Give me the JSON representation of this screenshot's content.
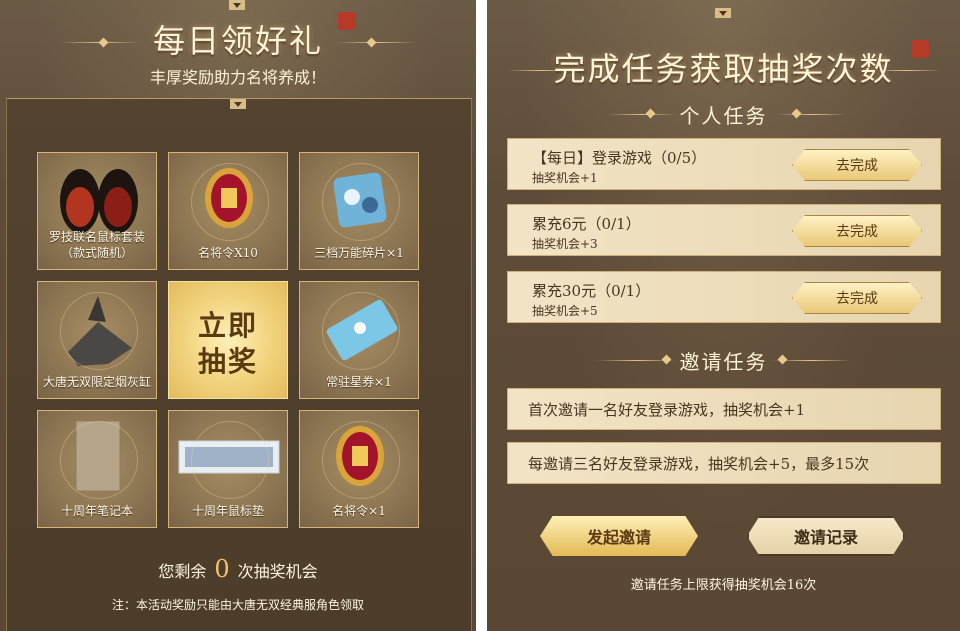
{
  "left": {
    "title": "每日领好礼",
    "subtitle": "丰厚奖励助力名将养成！",
    "grid": [
      {
        "label": "罗技联名鼠标套装\n（款式随机）",
        "icon": "mouse-set-icon"
      },
      {
        "label": "名将令X10",
        "icon": "token-icon"
      },
      {
        "label": "三档万能碎片×1",
        "icon": "fragment-icon"
      },
      {
        "label": "大唐无双限定烟灰缸",
        "icon": "ashtray-icon"
      },
      {
        "label": "立即\n抽奖",
        "icon": "draw-button"
      },
      {
        "label": "常驻星券×1",
        "icon": "ticket-icon"
      },
      {
        "label": "十周年笔记本",
        "icon": "notebook-icon"
      },
      {
        "label": "十周年鼠标垫",
        "icon": "mousepad-icon"
      },
      {
        "label": "名将令×1",
        "icon": "token-icon"
      }
    ],
    "remain_prefix": "您剩余",
    "remain_count": "0",
    "remain_suffix": "次抽奖机会",
    "note": "注：本活动奖励只能由大唐无双经典服角色领取"
  },
  "right": {
    "title": "完成任务获取抽奖次数",
    "personal_heading": "个人任务",
    "tasks": [
      {
        "name": "【每日】登录游戏（0/5）",
        "reward": "抽奖机会+1",
        "button": "去完成"
      },
      {
        "name": "累充6元（0/1）",
        "reward": "抽奖机会+3",
        "button": "去完成"
      },
      {
        "name": "累充30元（0/1）",
        "reward": "抽奖机会+5",
        "button": "去完成"
      }
    ],
    "invite_heading": "邀请任务",
    "invites": [
      "首次邀请一名好友登录游戏，抽奖机会+1",
      "每邀请三名好友登录游戏，抽奖机会+5，最多15次"
    ],
    "invite_button": "发起邀请",
    "record_button": "邀请记录",
    "footer": "邀请任务上限获得抽奖机会16次"
  },
  "colors": {
    "accent_gold": "#e9c878",
    "panel_brown": "#5e4c39",
    "card_cream": "#f2e4c6"
  }
}
